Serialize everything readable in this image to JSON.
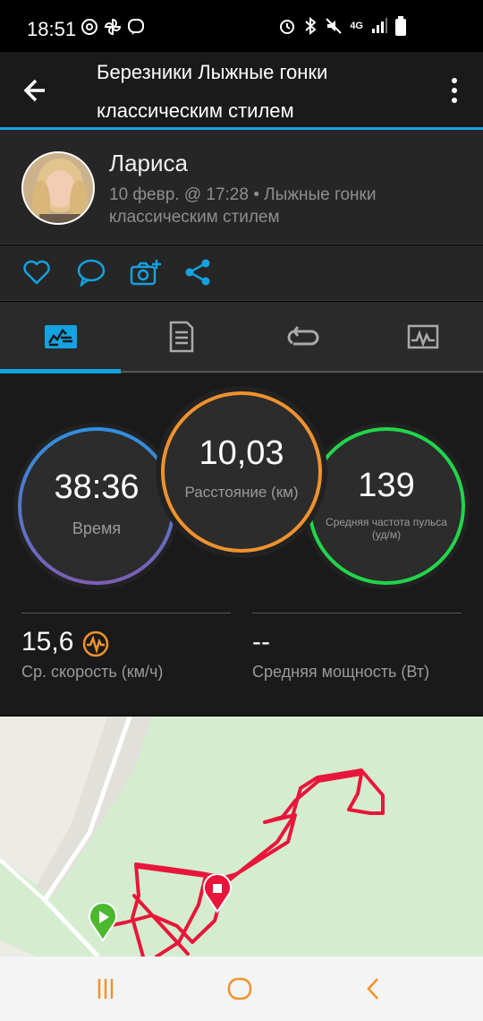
{
  "status_bar": {
    "time": "18:51",
    "network": "4G",
    "left_icons": [
      "at-sign-icon",
      "pinwheel-icon",
      "viber-icon"
    ],
    "right_icons": [
      "alarm-icon",
      "bluetooth-icon",
      "mute-icon",
      "network-icon",
      "signal-icon",
      "battery-icon"
    ]
  },
  "header": {
    "title_line1": "Березники Лыжные гонки",
    "title_line2": "классическим стилем",
    "accent_color": "#14a2e0"
  },
  "profile": {
    "name": "Лариса",
    "meta_line1": "10 февр. @ 17:28 • Лыжные гонки",
    "meta_line2": "классическим стилем"
  },
  "actions": [
    "heart-icon",
    "comment-icon",
    "add-photo-icon",
    "share-icon"
  ],
  "tabs": [
    {
      "name": "summary",
      "icon": "summary-chart-icon",
      "active": true
    },
    {
      "name": "details",
      "icon": "document-icon",
      "active": false
    },
    {
      "name": "laps",
      "icon": "laps-icon",
      "active": false
    },
    {
      "name": "charts",
      "icon": "graph-icon",
      "active": false
    }
  ],
  "stats": {
    "time": {
      "value": "38:36",
      "label": "Время"
    },
    "distance": {
      "value": "10,03",
      "label": "Расстояние (км)"
    },
    "heart_rate": {
      "value": "139",
      "label_line1": "Средняя частота пульса",
      "label_line2": "(уд/м)"
    },
    "speed": {
      "value": "15,6",
      "label": "Ср. скорость (км/ч)"
    },
    "power": {
      "value": "--",
      "label": "Средняя мощность (Вт)"
    }
  },
  "colors": {
    "time_ring_start": "#2f8fe0",
    "time_ring_end": "#7d5fb5",
    "distance_ring": "#f0922e",
    "heart_ring": "#22d44a",
    "speed_icon": "#f0922e",
    "route": "#e8163a",
    "start_marker": "#4cb82e",
    "end_marker": "#e8163a"
  },
  "map": {
    "start_marker": "play-marker-icon",
    "end_marker": "stop-marker-icon"
  },
  "nav": [
    "recent-apps-icon",
    "home-icon",
    "back-nav-icon"
  ]
}
